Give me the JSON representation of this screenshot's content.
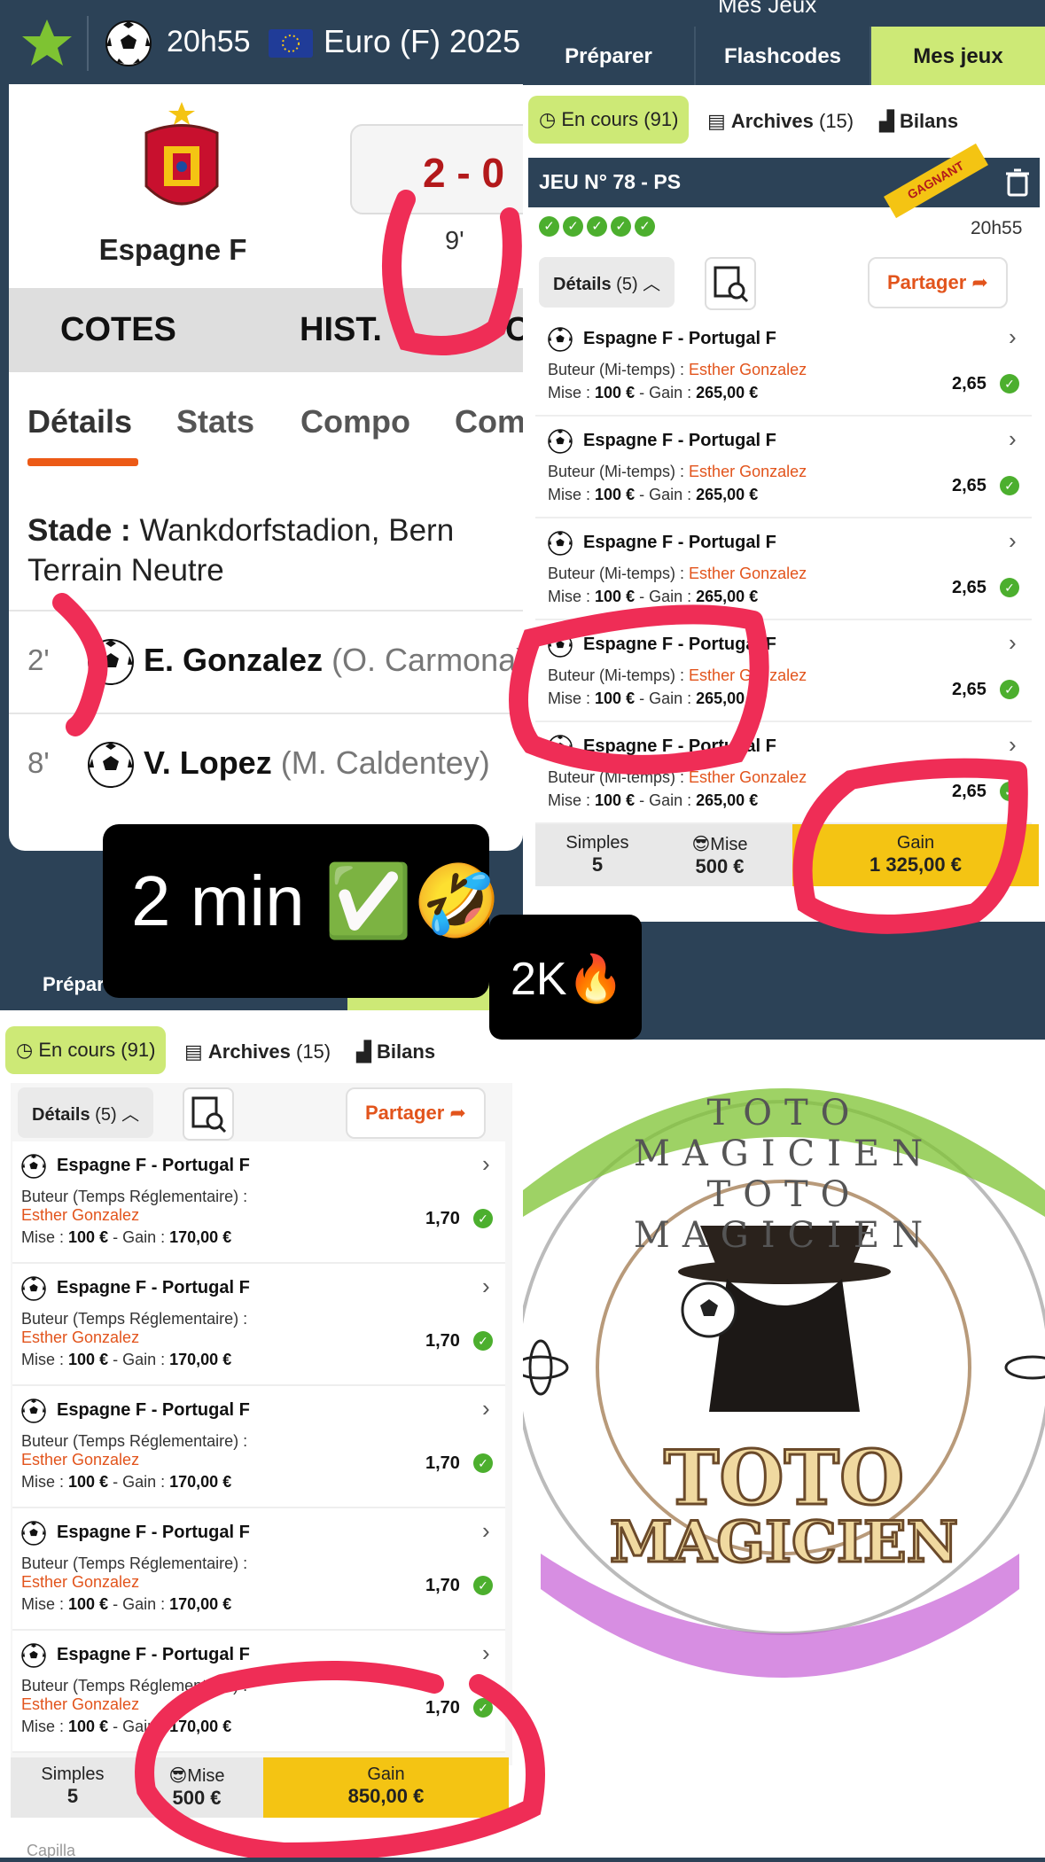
{
  "match": {
    "time": "20h55",
    "competition": "Euro (F) 2025",
    "team_home": "Espagne F",
    "score": "2 - 0",
    "minute": "9'",
    "tabs": [
      "COTES",
      "HIST.",
      "C"
    ],
    "subtabs": [
      "Détails",
      "Stats",
      "Compo",
      "Com"
    ],
    "venue_label": "Stade :",
    "venue_value": "Wankdorfstadion, Bern",
    "venue_note": "Terrain Neutre",
    "goals": [
      {
        "minute": "2'",
        "scorer": "E. Gonzalez",
        "assist": "(O. Carmona)"
      },
      {
        "minute": "8'",
        "scorer": "V. Lopez",
        "assist": "(M. Caldentey)"
      }
    ]
  },
  "right_panel": {
    "title": "Mes Jeux",
    "tabs": [
      "Préparer",
      "Flashcodes",
      "Mes jeux"
    ],
    "filters": {
      "en_cours": "En cours",
      "en_cours_count": "(91)",
      "archives": "Archives",
      "archives_count": "(15)",
      "bilans": "Bilans"
    },
    "jeu_title": "JEU N° 78 - PS",
    "ribbon": "GAGNANT",
    "time": "20h55",
    "details_label": "Détails",
    "details_count": "(5)",
    "share_label": "Partager",
    "bets": [
      {
        "match": "Espagne F - Portugal F",
        "type": "Buteur (Mi-temps) :",
        "player": "Esther Gonzalez",
        "mise_label": "Mise :",
        "mise": "100 €",
        "gain_label": "- Gain :",
        "gain": "265,00 €",
        "odds": "2,65"
      },
      {
        "match": "Espagne F - Portugal F",
        "type": "Buteur (Mi-temps) :",
        "player": "Esther Gonzalez",
        "mise_label": "Mise :",
        "mise": "100 €",
        "gain_label": "- Gain :",
        "gain": "265,00 €",
        "odds": "2,65"
      },
      {
        "match": "Espagne F - Portugal F",
        "type": "Buteur (Mi-temps) :",
        "player": "Esther Gonzalez",
        "mise_label": "Mise :",
        "mise": "100 €",
        "gain_label": "- Gain :",
        "gain": "265,00 €",
        "odds": "2,65"
      },
      {
        "match": "Espagne F - Portugal F",
        "type": "Buteur (Mi-temps) :",
        "player": "Esther Gonzalez",
        "mise_label": "Mise :",
        "mise": "100 €",
        "gain_label": "- Gain :",
        "gain": "265,00 €",
        "odds": "2,65"
      },
      {
        "match": "Espagne F - Portugal F",
        "type": "Buteur (Mi-temps) :",
        "player": "Esther Gonzalez",
        "mise_label": "Mise :",
        "mise": "100 €",
        "gain_label": "- Gain :",
        "gain": "265,00 €",
        "odds": "2,65"
      }
    ],
    "footer": {
      "simples_label": "Simples",
      "simples_value": "5",
      "mise_label": "😎Mise",
      "mise_value": "500 €",
      "gain_label": "Gain",
      "gain_value": "1 325,00 €"
    }
  },
  "left_panel": {
    "tab_visible": "Prépar",
    "filters": {
      "en_cours": "En cours",
      "en_cours_count": "(91)",
      "archives": "Archives",
      "archives_count": "(15)",
      "bilans": "Bilans"
    },
    "details_label": "Détails",
    "details_count": "(5)",
    "share_label": "Partager",
    "bets": [
      {
        "match": "Espagne F - Portugal F",
        "type": "Buteur (Temps Réglementaire) :",
        "player": "Esther Gonzalez",
        "mise_label": "Mise :",
        "mise": "100 €",
        "gain_label": "- Gain :",
        "gain": "170,00 €",
        "odds": "1,70"
      },
      {
        "match": "Espagne F - Portugal F",
        "type": "Buteur (Temps Réglementaire) :",
        "player": "Esther Gonzalez",
        "mise_label": "Mise :",
        "mise": "100 €",
        "gain_label": "- Gain :",
        "gain": "170,00 €",
        "odds": "1,70"
      },
      {
        "match": "Espagne F - Portugal F",
        "type": "Buteur (Temps Réglementaire) :",
        "player": "Esther Gonzalez",
        "mise_label": "Mise :",
        "mise": "100 €",
        "gain_label": "- Gain :",
        "gain": "170,00 €",
        "odds": "1,70"
      },
      {
        "match": "Espagne F - Portugal F",
        "type": "Buteur (Temps Réglementaire) :",
        "player": "Esther Gonzalez",
        "mise_label": "Mise :",
        "mise": "100 €",
        "gain_label": "- Gain :",
        "gain": "170,00 €",
        "odds": "1,70"
      },
      {
        "match": "Espagne F - Portugal F",
        "type": "Buteur (Temps Réglementaire) :",
        "player": "Esther Gonzalez",
        "mise_label": "Mise :",
        "mise": "100 €",
        "gain_label": "- Gain :",
        "gain": "170,00 €",
        "odds": "1,70"
      }
    ],
    "footer": {
      "simples_label": "Simples",
      "simples_value": "5",
      "mise_label": "😎Mise",
      "mise_value": "500 €",
      "gain_label": "Gain",
      "gain_value": "850,00 €"
    },
    "bottom_text": "Capilla"
  },
  "overlays": {
    "badge_main": "2 min ✅🤣",
    "badge_views": "2K🔥"
  },
  "logo": {
    "line1": "TOTO",
    "line2": "MAGICIEN",
    "ring_text": "TOTO MAGICIEN TOTO MAGICIEN"
  },
  "colors": {
    "accent_green": "#cde976",
    "navy": "#2c4257",
    "orange": "#e2541c",
    "gain_yellow": "#f4c413",
    "check_green": "#4caf2e",
    "score_red": "#b3191b"
  }
}
